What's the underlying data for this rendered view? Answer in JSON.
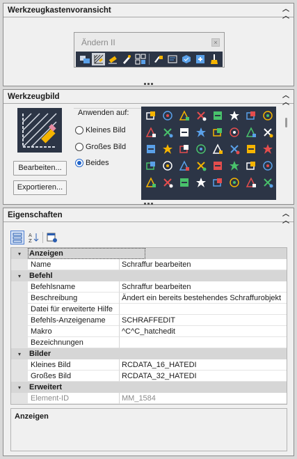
{
  "panels": {
    "preview": {
      "title": "Werkzeugkastenvoransicht",
      "toolbar_name": "Ändern II",
      "toolbar_close": "×"
    },
    "image": {
      "title": "Werkzeugbild",
      "edit_button": "Bearbeiten...",
      "export_button": "Exportieren...",
      "apply_label": "Anwenden auf:",
      "options": [
        {
          "label": "Kleines Bild",
          "selected": false
        },
        {
          "label": "Großes Bild",
          "selected": false
        },
        {
          "label": "Beides",
          "selected": true
        }
      ]
    },
    "properties": {
      "title": "Eigenschaften",
      "rows": [
        {
          "type": "cat",
          "label": "Anzeigen"
        },
        {
          "type": "prop",
          "key": "Name",
          "value": "Schraffur bearbeiten"
        },
        {
          "type": "cat",
          "label": "Befehl"
        },
        {
          "type": "prop",
          "key": "Befehlsname",
          "value": "Schraffur bearbeiten"
        },
        {
          "type": "prop",
          "key": "Beschreibung",
          "value": "Ändert ein bereits bestehendes Schraffurobjekt"
        },
        {
          "type": "prop",
          "key": "Datei für erweiterte Hilfe",
          "value": ""
        },
        {
          "type": "prop",
          "key": "Befehls-Anzeigename",
          "value": "SCHRAFFEDIT"
        },
        {
          "type": "prop",
          "key": "Makro",
          "value": "^C^C_hatchedit"
        },
        {
          "type": "prop",
          "key": "Bezeichnungen",
          "value": ""
        },
        {
          "type": "cat",
          "label": "Bilder"
        },
        {
          "type": "prop",
          "key": "Kleines Bild",
          "value": "RCDATA_16_HATEDI"
        },
        {
          "type": "prop",
          "key": "Großes Bild",
          "value": "RCDATA_32_HATEDI"
        },
        {
          "type": "cat",
          "label": "Erweitert"
        },
        {
          "type": "prop",
          "key": "Element-ID",
          "value": "MM_1584",
          "disabled": true
        }
      ],
      "description_title": "Anzeigen"
    }
  },
  "colors": {
    "toolbar_bg": "#2c3546",
    "accent": "#1f63c9",
    "icon_orange": "#f5b400"
  },
  "toolbar_icons": [
    "draworder-icon",
    "hatch-edit-icon",
    "erase-icon",
    "pen-icon",
    "array-icon",
    "match-props-icon",
    "attribute-icon",
    "block-edit-icon",
    "refedit-icon",
    "cleanup-icon"
  ],
  "grid_icons": [
    "box-icon",
    "number-13-icon",
    "layer-icon",
    "folder-icon",
    "circle-arrow-icon",
    "target-icon",
    "camera-icon",
    "plane-icon",
    "footsteps-icon",
    "plane-icon",
    "magnet-icon",
    "rotate-icon",
    "hand-icon",
    "cube-arrow-icon",
    "box-3d-icon",
    "cube-icon",
    "camera-icon",
    "triangle-icon",
    "book-icon",
    "search-icon",
    "print-icon",
    "dwf-icon",
    "print-icon",
    "puzzle-icon",
    "delete-icon",
    "bracket-icon",
    "cut-icon",
    "arc-icon",
    "text-icon",
    "measure-icon",
    "ruler-icon",
    "bat-icon",
    "flag-icon",
    "lightning-icon",
    "circle-icon",
    "square-icon",
    "table-icon",
    "move-icon",
    "plus-icon",
    "x-icon"
  ]
}
